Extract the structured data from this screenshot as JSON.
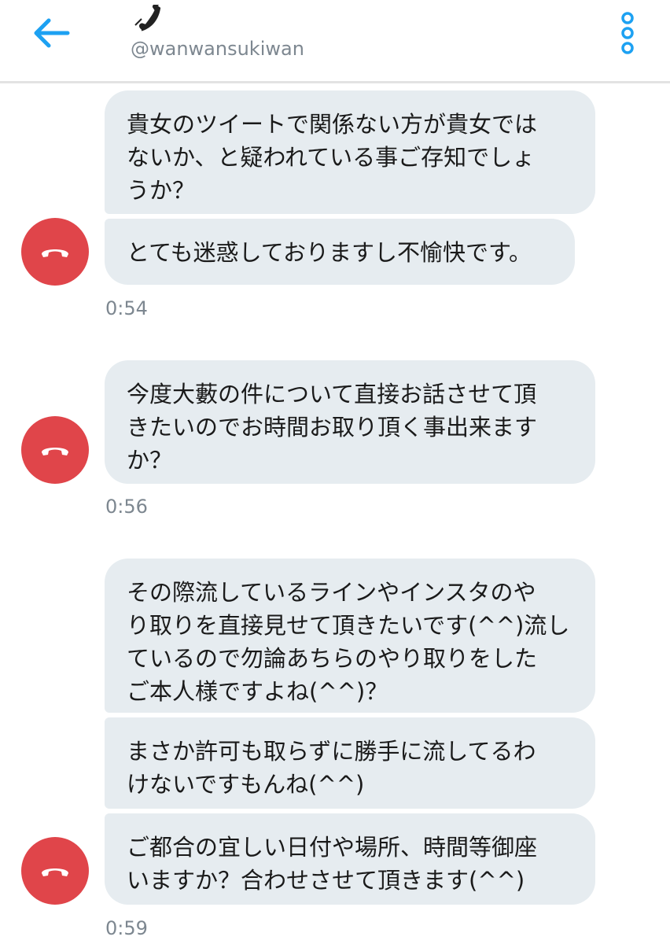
{
  "header": {
    "handle": "@wanwansukiwan"
  },
  "messages": [
    {
      "bubbles": [
        "貴女のツイートで関係ない方が貴女では\nないか、と疑われている事ご存知でしょ\nうか？",
        "とても迷惑しておりますし不愉快です。"
      ],
      "time": "0:54"
    },
    {
      "bubbles": [
        "今度大藪の件について直接お話させて頂\nきたいのでお時間お取り頂く事出来ます\nか？"
      ],
      "time": "0:56"
    },
    {
      "bubbles": [
        "その際流しているラインやインスタのや\nり取りを直接見せて頂きたいです(^^)流し\nているので勿論あちらのやり取りをした\nご本人様ですよね(^^)？",
        "まさか許可も取らずに勝手に流してるわ\nけないですもんね(^^)",
        "ご都合の宜しい日付や場所、時間等御座\nいますか？合わせさせて頂きます(^^)"
      ],
      "time": "0:59"
    }
  ],
  "colors": {
    "accent": "#1da1f2",
    "bubble": "#e6ecf0",
    "call_red": "#e0454a",
    "muted_text": "#7d8790"
  },
  "icons": {
    "back": "back-arrow-icon",
    "menu": "more-vertical-icon",
    "phone": "phone-icon",
    "end_call": "end-call-icon"
  }
}
